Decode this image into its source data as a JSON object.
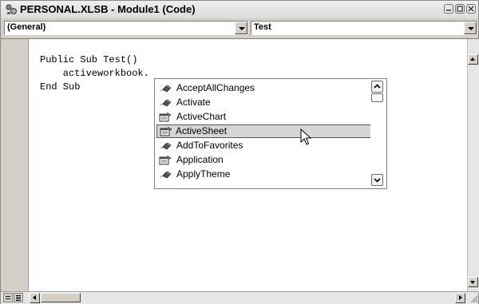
{
  "window": {
    "title": "PERSONAL.XLSB - Module1 (Code)",
    "icon": "vba-project-icon"
  },
  "object_combo": {
    "value": "(General)"
  },
  "procedure_combo": {
    "value": "Test"
  },
  "code": {
    "lines": [
      "Public Sub Test()",
      "    activeworkbook.",
      "End Sub"
    ]
  },
  "autocomplete": {
    "items": [
      {
        "label": "AcceptAllChanges",
        "kind": "method-icon"
      },
      {
        "label": "Activate",
        "kind": "method-icon"
      },
      {
        "label": "ActiveChart",
        "kind": "property-icon"
      },
      {
        "label": "ActiveSheet",
        "kind": "property-icon",
        "selected": true
      },
      {
        "label": "AddToFavorites",
        "kind": "method-icon"
      },
      {
        "label": "Application",
        "kind": "property-icon"
      },
      {
        "label": "ApplyTheme",
        "kind": "method-icon"
      }
    ]
  }
}
